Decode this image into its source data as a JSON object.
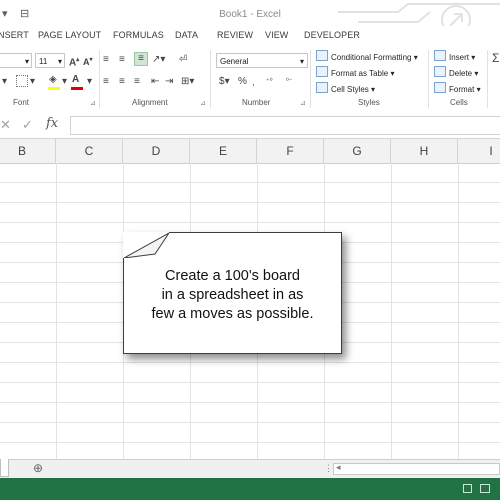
{
  "window": {
    "title": "Book1 - Excel"
  },
  "ribbon_tabs": [
    "NSERT",
    "PAGE LAYOUT",
    "FORMULAS",
    "DATA",
    "REVIEW",
    "VIEW",
    "DEVELOPER"
  ],
  "font_group": {
    "size_value": "11",
    "label": "Font"
  },
  "alignment_group": {
    "label": "Alignment"
  },
  "number_group": {
    "format_value": "General",
    "currency": "$",
    "percent": "%",
    "label": "Number"
  },
  "styles_group": {
    "conditional_formatting": "Conditional Formatting",
    "format_as_table": "Format as Table",
    "cell_styles": "Cell Styles",
    "label": "Styles"
  },
  "cells_group": {
    "insert": "Insert",
    "delete": "Delete",
    "format": "Format",
    "label": "Cells"
  },
  "formula_bar": {
    "fx": "fx",
    "value": ""
  },
  "columns": [
    "B",
    "C",
    "D",
    "E",
    "F",
    "G",
    "H",
    "I"
  ],
  "callout": {
    "line1": "Create a 100's board",
    "line2": "in a spreadsheet in as",
    "line3": "few a moves as possible."
  },
  "sheet_bar": {
    "add_sheet": "⊕"
  },
  "colors": {
    "excel_green": "#217346",
    "grid_line": "#e3e3e3"
  }
}
